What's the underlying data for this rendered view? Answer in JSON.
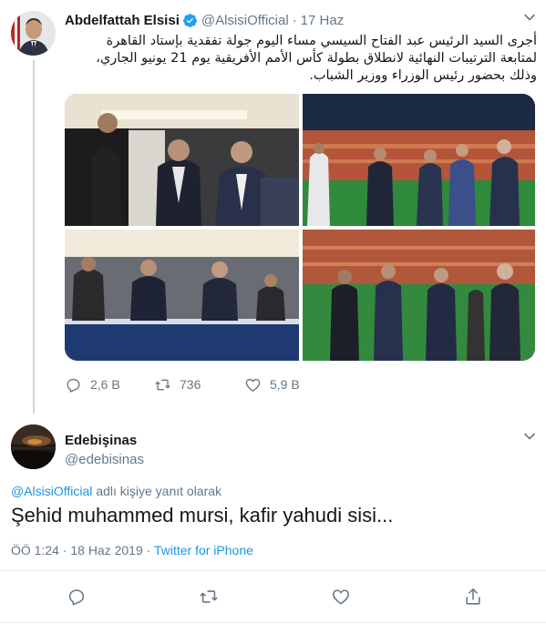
{
  "tweet": {
    "author_name": "Abdelfattah Elsisi",
    "handle": "@AlsisiOfficial",
    "separator": "·",
    "date": "17 Haz",
    "text_line1": "أجرى السيد الرئيس عبد الفتاح السيسي مساء اليوم جولة تفقدية بإستاد القاهرة",
    "text_line2": "لمتابعة الترتيبات النهائية لانطلاق بطولة كأس الأمم الأفريقية يوم 21 يونيو الجاري،",
    "text_line3": "وذلك بحضور رئيس الوزراء ووزير الشباب.",
    "actions": {
      "replies": "2,6 B",
      "retweets": "736",
      "likes": "5,9 B"
    },
    "media_count": 4
  },
  "reply": {
    "author_name": "Edebişinas",
    "handle": "@edebisinas",
    "reply_to_handle": "@AlsisiOfficial",
    "reply_context_suffix": "adlı kişiye yanıt olarak",
    "text": "Şehid muhammed mursi, kafir yahudi sisi...",
    "time_date": "ÖÖ 1:24 · 18 Haz 2019 ·",
    "source": "Twitter for iPhone"
  },
  "colors": {
    "accent": "#1b95e0",
    "secondary_text": "#657786",
    "divider": "#e6ecf0",
    "verified": "#1da1f2"
  },
  "icons": [
    "chevron-down-icon",
    "verified-badge-icon",
    "reply-icon",
    "retweet-icon",
    "like-icon",
    "share-icon"
  ]
}
